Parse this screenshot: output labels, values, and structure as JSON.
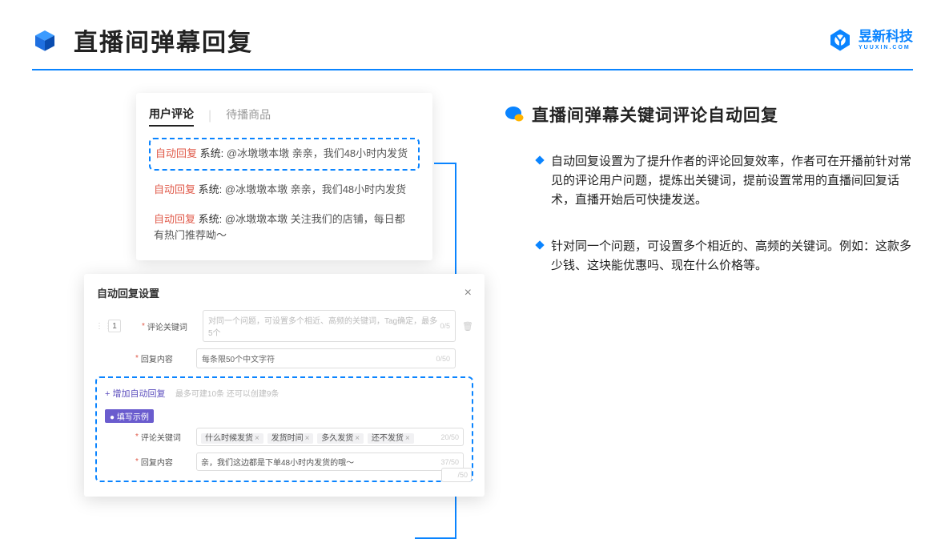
{
  "header": {
    "title": "直播间弹幕回复",
    "brand_cn": "昱新科技",
    "brand_en": "YUUXIN.COM"
  },
  "right": {
    "heading": "直播间弹幕关键词评论自动回复",
    "bullets": [
      "自动回复设置为了提升作者的评论回复效率，作者可在开播前针对常见的评论用户问题，提炼出关键词，提前设置常用的直播间回复话术，直播开始后可快捷发送。",
      "针对同一个问题，可设置多个相近的、高频的关键词。例如：这款多少钱、这块能优惠吗、现在什么价格等。"
    ]
  },
  "tabs": {
    "active": "用户评论",
    "inactive": "待播商品"
  },
  "comments": [
    {
      "pre": "自动回复",
      "sys": "系统:",
      "text": "@冰墩墩本墩 亲亲，我们48小时内发货"
    },
    {
      "pre": "自动回复",
      "sys": "系统:",
      "text": "@冰墩墩本墩 亲亲，我们48小时内发货"
    },
    {
      "pre": "自动回复",
      "sys": "系统:",
      "text": "@冰墩墩本墩 关注我们的店铺，每日都有热门推荐呦～"
    }
  ],
  "modal": {
    "title": "自动回复设置",
    "num": "1",
    "row1": {
      "label": "评论关键词",
      "placeholder": "对同一个问题，可设置多个相近、高频的关键词，Tag确定，最多5个",
      "counter": "0/5"
    },
    "row2": {
      "label": "回复内容",
      "placeholder": "每条限50个中文字符",
      "counter": "0/50"
    },
    "add_link": "+ 增加自动回复",
    "add_sub": "最多可建10条 还可以创建9条",
    "pill": "● 填写示例",
    "ex_row1": {
      "label": "评论关键词",
      "tags": [
        "什么时候发货",
        "发货时间",
        "多久发货",
        "还不发货"
      ],
      "counter": "20/50"
    },
    "ex_row2": {
      "label": "回复内容",
      "text": "亲，我们这边都是下单48小时内发货的哦～",
      "counter": "37/50"
    },
    "half": "/50"
  }
}
